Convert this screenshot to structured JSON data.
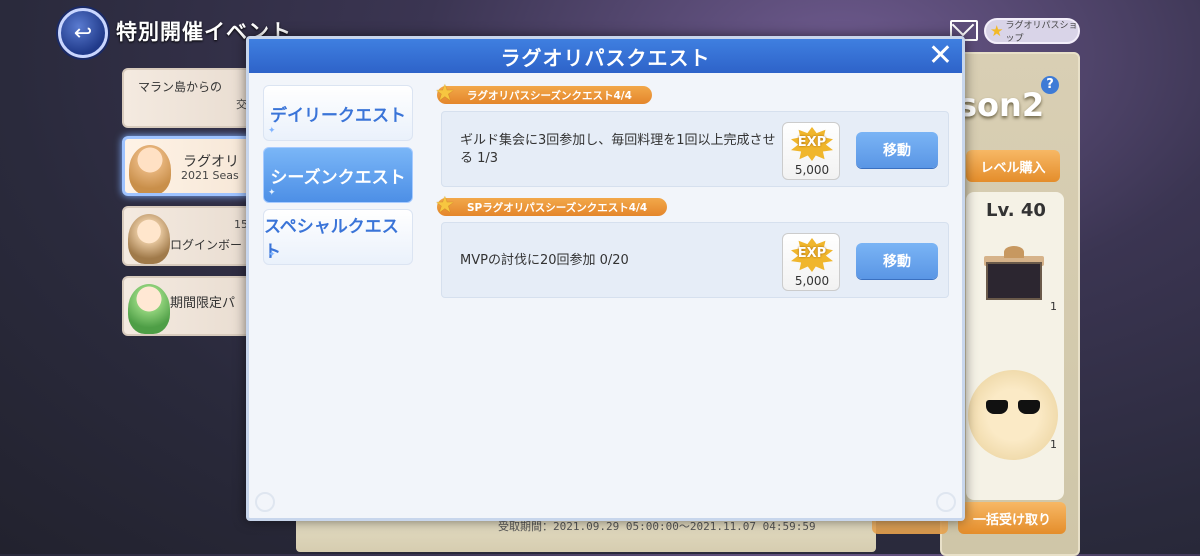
{
  "header": {
    "title": "特別開催イベント",
    "back_icon": "back-arrow-icon",
    "shop_label": "ラグオリパスショップ"
  },
  "event_list": [
    {
      "label": "マラン島からの",
      "sub": "交",
      "active": false
    },
    {
      "label": "ラグオリ",
      "sub": "2021 Seas",
      "active": true
    },
    {
      "label": "ログインボー",
      "sub": "15",
      "active": false
    },
    {
      "label": "期間限定パ",
      "sub": "",
      "active": false
    }
  ],
  "season_panel": {
    "season_text": "son2",
    "help": "?",
    "level_buy": "レベル購入",
    "level": "Lv. 40",
    "reward_count_1": "1",
    "reward_count_2": "1",
    "bulk_receive": "一括受け取り",
    "period": "受取期間：2021.09.29 05:00:00～2021.11.07 04:59:59"
  },
  "modal": {
    "title": "ラグオリパスクエスト",
    "close_label": "✕",
    "tabs": [
      {
        "label": "デイリークエスト",
        "active": false
      },
      {
        "label": "シーズンクエスト",
        "active": true
      },
      {
        "label": "スペシャルクエスト",
        "active": false
      }
    ],
    "sections": [
      {
        "label": "ラグオリパスシーズンクエスト4/4",
        "quest": {
          "description": "ギルド集会に3回参加し、毎回料理を1回以上完成させる 1/3",
          "reward_label": "EXP",
          "reward_amount": "5,000",
          "button": "移動"
        }
      },
      {
        "label": "SPラグオリパスシーズンクエスト4/4",
        "quest": {
          "description": "MVPの討伐に20回参加 0/20",
          "reward_label": "EXP",
          "reward_amount": "5,000",
          "button": "移動"
        }
      }
    ]
  },
  "colors": {
    "header_blue": "#2e63c9",
    "active_tab": "#4d8fe6",
    "section_orange": "#e4862b",
    "exp_gold": "#f0b62c",
    "move_button": "#5a96e5"
  }
}
